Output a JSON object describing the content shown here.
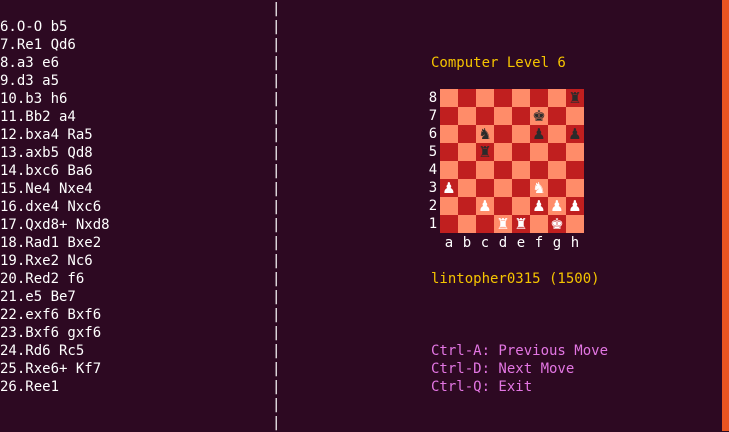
{
  "moves": [
    "6.O-O b5",
    "7.Re1 Qd6",
    "8.a3 e6",
    "9.d3 a5",
    "10.b3 h6",
    "11.Bb2 a4",
    "12.bxa4 Ra5",
    "13.axb5 Qd8",
    "14.bxc6 Ba6",
    "15.Ne4 Nxe4",
    "16.dxe4 Nxc6",
    "17.Qxd8+ Nxd8",
    "18.Rad1 Bxe2",
    "19.Rxe2 Nc6",
    "20.Red2 f6",
    "21.e5 Be7",
    "22.exf6 Bxf6",
    "23.Bxf6 gxf6",
    "24.Rd6 Rc5",
    "25.Rxe6+ Kf7",
    "26.Ree1"
  ],
  "divider_char": "|",
  "opponent_label": "Computer Level 6",
  "player_label": "lintopher0315 (1500)",
  "board": {
    "ranks": [
      "8",
      "7",
      "6",
      "5",
      "4",
      "3",
      "2",
      "1"
    ],
    "files": [
      "a",
      "b",
      "c",
      "d",
      "e",
      "f",
      "g",
      "h"
    ],
    "rows": [
      [
        "",
        "",
        "",
        "",
        "",
        "",
        "",
        "bR"
      ],
      [
        "",
        "",
        "",
        "",
        "",
        "bK",
        "",
        ""
      ],
      [
        "",
        "",
        "bN",
        "",
        "",
        "bP",
        "",
        "bP"
      ],
      [
        "",
        "",
        "bR",
        "",
        "",
        "",
        "",
        ""
      ],
      [
        "",
        "",
        "",
        "",
        "",
        "",
        "",
        ""
      ],
      [
        "wP",
        "",
        "",
        "",
        "",
        "wN",
        "",
        ""
      ],
      [
        "",
        "",
        "wP",
        "",
        "",
        "wP",
        "wP",
        "wP"
      ],
      [
        "",
        "",
        "",
        "wR",
        "wR",
        "",
        "wK",
        ""
      ]
    ]
  },
  "pieces": {
    "K": "♚",
    "Q": "♛",
    "R": "♜",
    "B": "♝",
    "N": "♞",
    "P": "♟"
  },
  "help": [
    "Ctrl-A: Previous Move",
    "Ctrl-D: Next Move",
    "Ctrl-Q: Exit"
  ]
}
